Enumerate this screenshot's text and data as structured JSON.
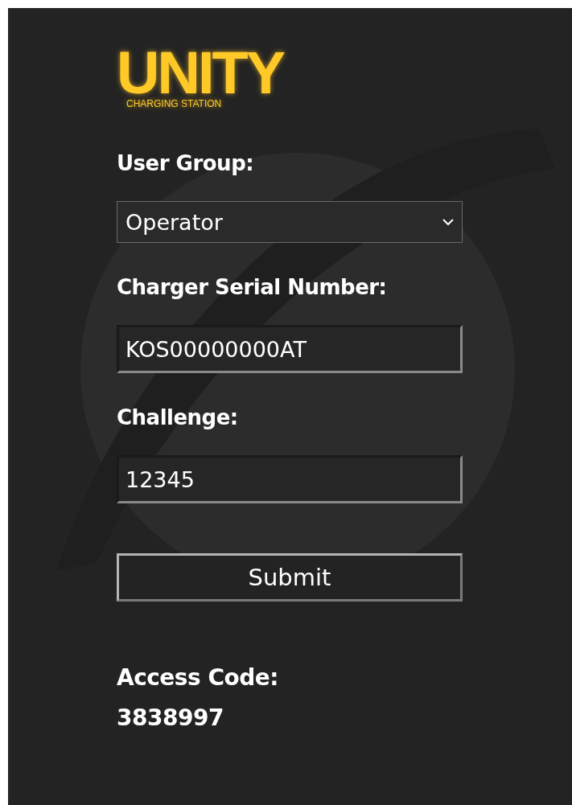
{
  "logo": {
    "title": "UNITY",
    "subtitle": "CHARGING STATION"
  },
  "fields": [
    {
      "kind": "select",
      "label": "User Group:",
      "value": "Operator"
    },
    {
      "kind": "text",
      "label": "Charger Serial Number:",
      "value": "KOS00000000AT"
    },
    {
      "kind": "text",
      "label": "Challenge:",
      "value": "12345"
    }
  ],
  "button": "Submit",
  "result": {
    "label": "Access Code:",
    "value": "3838997"
  }
}
